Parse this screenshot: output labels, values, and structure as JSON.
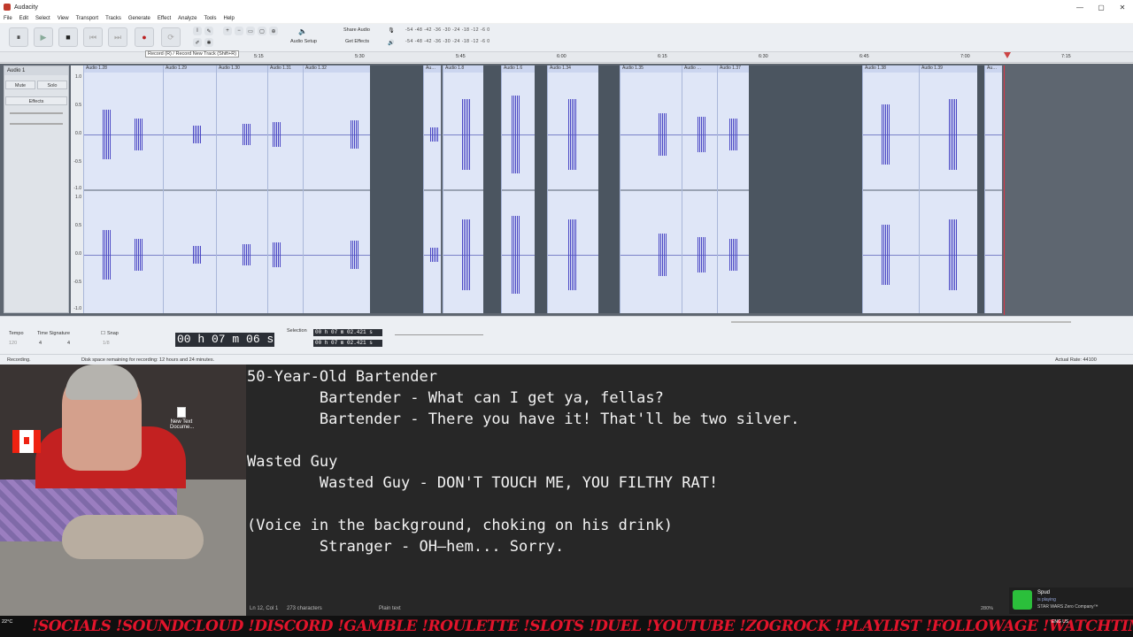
{
  "audacity": {
    "title": "Audacity",
    "window_controls": [
      "—",
      "▢",
      "✕"
    ],
    "menu": [
      "File",
      "Edit",
      "Select",
      "View",
      "Transport",
      "Tracks",
      "Generate",
      "Effect",
      "Analyze",
      "Tools",
      "Help"
    ],
    "toolbar": {
      "pause_icon": "⏸",
      "play_icon": "▶",
      "stop_icon": "■",
      "skip_start_icon": "⏮",
      "skip_end_icon": "⏭",
      "record_icon": "●",
      "loop_icon": "⟳",
      "record_tooltip": "Record (R) / Record New Track (Shift+R)",
      "audio_setup": "Audio Setup",
      "share_audio": "Share Audio",
      "get_effects": "Get Effects",
      "meter_scale": "-54 -48 -42 -36 -30 -24 -18 -12 -6 0"
    },
    "ruler_ticks": [
      "5:15",
      "5:30",
      "5:45",
      "6:00",
      "6:15",
      "6:30",
      "6:45",
      "7:00",
      "7:15"
    ],
    "track": {
      "name": "Audio 1",
      "mute": "Mute",
      "solo": "Solo",
      "effects": "Effects"
    },
    "scale_labels": [
      "1.0",
      "0.5",
      "0.0",
      "-0.5",
      "-1.0",
      "1.0",
      "0.5",
      "0.0",
      "-0.5",
      "-1.0"
    ],
    "clips": [
      "Audio 1.28",
      "Audio 1.29",
      "Audio 1.30",
      "Audio 1.31",
      "Audio 1.32",
      "Au…",
      "Audio 1.8",
      "Audio 1.6",
      "Audio 1.34",
      "Audio 1.35",
      "Audio …",
      "Audio 1.37",
      "Audio 1.38",
      "Audio 1.39",
      "Au…"
    ],
    "bottom": {
      "tempo_label": "Tempo",
      "tempo_value": "120",
      "time_sig_label": "Time Signature",
      "time_sig_num": "4",
      "time_sig_den": "4",
      "snap_label": "Snap",
      "snap_value": "1/8",
      "time_display": "00 h 07 m 06 s",
      "selection_label": "Selection",
      "selection_start": "00 h 07 m 02.421 s",
      "selection_end": "00 h 07 m 02.421 s"
    },
    "status": {
      "state": "Recording.",
      "disk": "Disk space remaining for recording: 12 hours and 24 minutes.",
      "rate": "Actual Rate: 44100"
    }
  },
  "notepad": {
    "lines": [
      "50-Year-Old Bartender",
      "        Bartender - What can I get ya, fellas?",
      "        Bartender - There you have it! That'll be two silver.",
      "",
      "Wasted Guy",
      "        Wasted Guy - DON'T TOUCH ME, YOU FILTHY RAT!",
      "",
      "(Voice in the background, choking on his drink)",
      "        Stranger - OH—hem... Sorry."
    ],
    "status": {
      "position": "Ln 12, Col 1",
      "chars": "273 characters",
      "format": "Plain text"
    }
  },
  "desktop": {
    "new_text_doc": "New Text Docume..."
  },
  "overlay": {
    "spud_name": "Spud",
    "spud_status": "is playing",
    "spud_game": "STAR WARS Zero Company™",
    "zoom": "280%",
    "ticker": "!SOCIALS   !SOUNDCLOUD   !DISCORD   !GAMBLE   !ROULETTE   !SLOTS   !DUEL   !YOUTUBE   !ZOGROCK   !PLAYLIST   !FOLLOWAGE   !WATCHTIME",
    "temp": "22°C",
    "sys_lang": "ENG US"
  }
}
